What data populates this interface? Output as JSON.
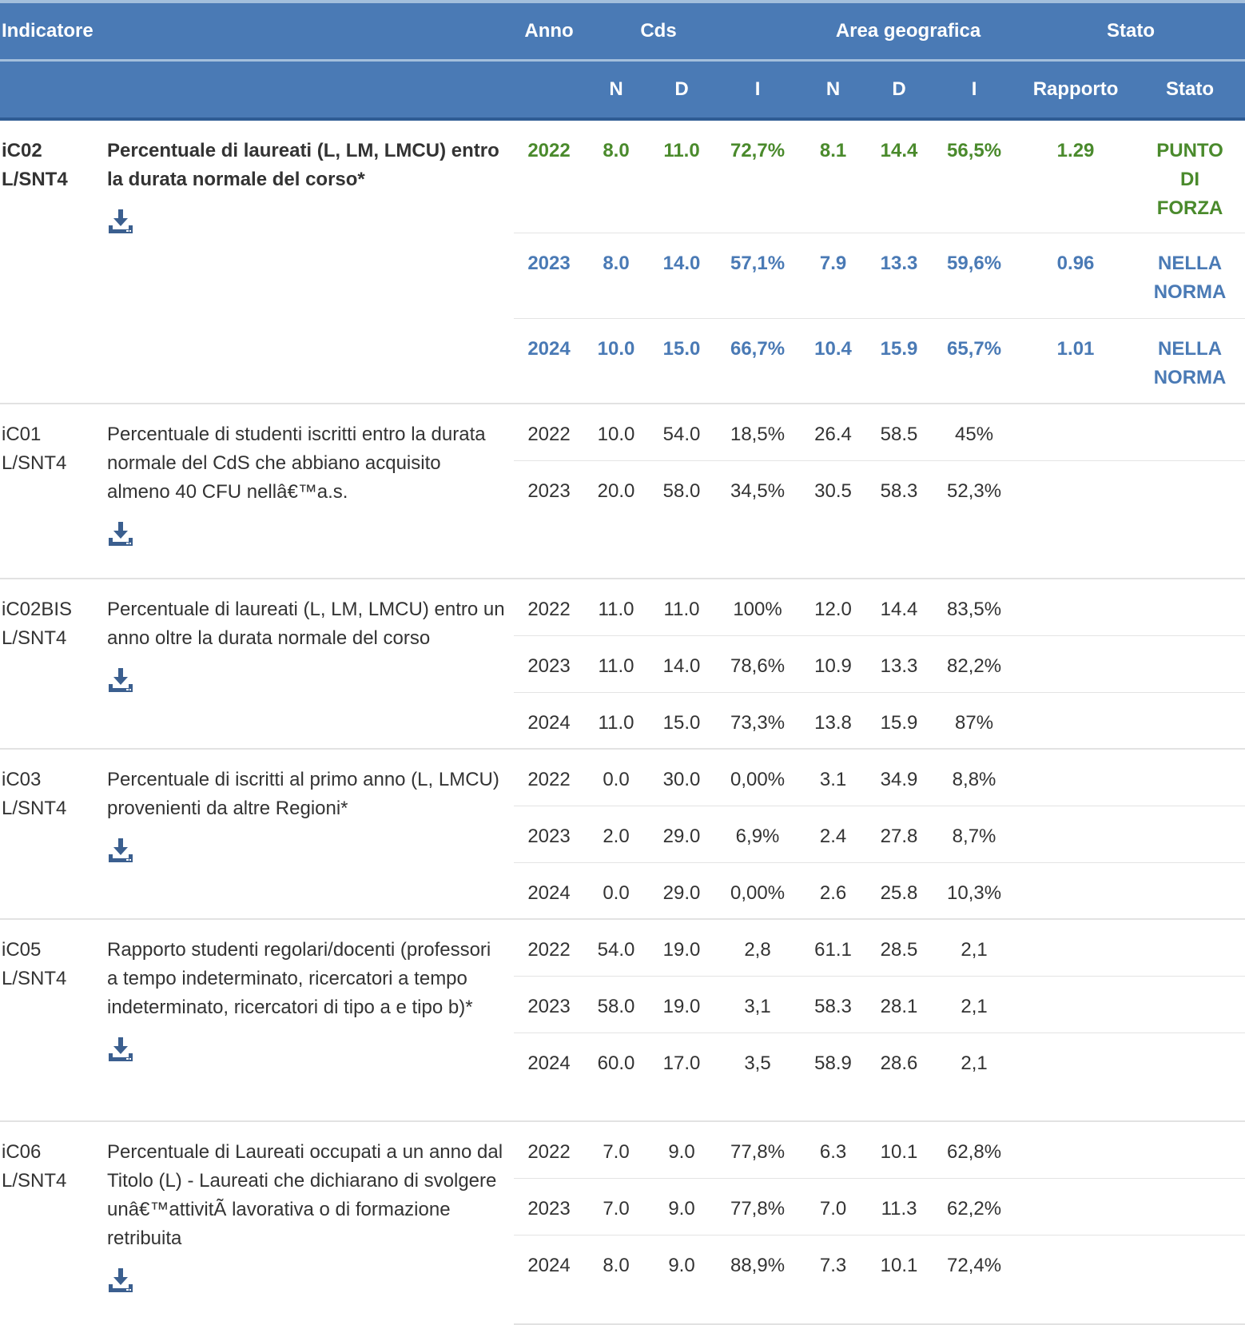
{
  "header": {
    "indicatore": "Indicatore",
    "anno": "Anno",
    "cds": "Cds",
    "area": "Area geografica",
    "stato": "Stato",
    "sub_n": "N",
    "sub_d": "D",
    "sub_i": "I",
    "sub_rapporto": "Rapporto",
    "sub_stato": "Stato"
  },
  "colors": {
    "header_bg": "#4a7ab5",
    "positive": "#4a8a2c",
    "normal": "#4a7ab5"
  },
  "icon": "download-icon",
  "indicators": [
    {
      "code": "iC02 L/SNT4",
      "desc": "Percentuale di laureati (L, LM, LMCU) entro la durata normale del corso*",
      "rows": [
        {
          "anno": "2022",
          "n": "8.0",
          "d": "11.0",
          "i": "72,7%",
          "an": "8.1",
          "ad": "14.4",
          "ai": "56,5%",
          "rapporto": "1.29",
          "stato": "PUNTO DI FORZA",
          "color": "green"
        },
        {
          "anno": "2023",
          "n": "8.0",
          "d": "14.0",
          "i": "57,1%",
          "an": "7.9",
          "ad": "13.3",
          "ai": "59,6%",
          "rapporto": "0.96",
          "stato": "NELLA NORMA",
          "color": "blue"
        },
        {
          "anno": "2024",
          "n": "10.0",
          "d": "15.0",
          "i": "66,7%",
          "an": "10.4",
          "ad": "15.9",
          "ai": "65,7%",
          "rapporto": "1.01",
          "stato": "NELLA NORMA",
          "color": "blue"
        }
      ]
    },
    {
      "code": "iC01 L/SNT4",
      "desc": "Percentuale di studenti iscritti entro la durata normale del CdS che abbiano acquisito almeno 40 CFU nellâ€™a.s.",
      "rows": [
        {
          "anno": "2022",
          "n": "10.0",
          "d": "54.0",
          "i": "18,5%",
          "an": "26.4",
          "ad": "58.5",
          "ai": "45%"
        },
        {
          "anno": "2023",
          "n": "20.0",
          "d": "58.0",
          "i": "34,5%",
          "an": "30.5",
          "ad": "58.3",
          "ai": "52,3%"
        }
      ]
    },
    {
      "code": "iC02BIS L/SNT4",
      "desc": "Percentuale di laureati (L, LM, LMCU) entro un anno oltre la durata normale del corso",
      "rows": [
        {
          "anno": "2022",
          "n": "11.0",
          "d": "11.0",
          "i": "100%",
          "an": "12.0",
          "ad": "14.4",
          "ai": "83,5%"
        },
        {
          "anno": "2023",
          "n": "11.0",
          "d": "14.0",
          "i": "78,6%",
          "an": "10.9",
          "ad": "13.3",
          "ai": "82,2%"
        },
        {
          "anno": "2024",
          "n": "11.0",
          "d": "15.0",
          "i": "73,3%",
          "an": "13.8",
          "ad": "15.9",
          "ai": "87%"
        }
      ]
    },
    {
      "code": "iC03 L/SNT4",
      "desc": "Percentuale di iscritti al primo anno (L, LMCU) provenienti da altre Regioni*",
      "rows": [
        {
          "anno": "2022",
          "n": "0.0",
          "d": "30.0",
          "i": "0,00%",
          "an": "3.1",
          "ad": "34.9",
          "ai": "8,8%"
        },
        {
          "anno": "2023",
          "n": "2.0",
          "d": "29.0",
          "i": "6,9%",
          "an": "2.4",
          "ad": "27.8",
          "ai": "8,7%"
        },
        {
          "anno": "2024",
          "n": "0.0",
          "d": "29.0",
          "i": "0,00%",
          "an": "2.6",
          "ad": "25.8",
          "ai": "10,3%"
        }
      ]
    },
    {
      "code": "iC05 L/SNT4",
      "desc": "Rapporto studenti regolari/docenti (professori a tempo indeterminato, ricercatori a tempo indeterminato, ricercatori di tipo a e tipo b)*",
      "rows": [
        {
          "anno": "2022",
          "n": "54.0",
          "d": "19.0",
          "i": "2,8",
          "an": "61.1",
          "ad": "28.5",
          "ai": "2,1"
        },
        {
          "anno": "2023",
          "n": "58.0",
          "d": "19.0",
          "i": "3,1",
          "an": "58.3",
          "ad": "28.1",
          "ai": "2,1"
        },
        {
          "anno": "2024",
          "n": "60.0",
          "d": "17.0",
          "i": "3,5",
          "an": "58.9",
          "ad": "28.6",
          "ai": "2,1"
        }
      ]
    },
    {
      "code": "iC06 L/SNT4",
      "desc": "Percentuale di Laureati occupati a un anno dal Titolo (L) - Laureati che dichiarano di svolgere unâ€™attivitÃ  lavorativa o di formazione retribuita",
      "rows": [
        {
          "anno": "2022",
          "n": "7.0",
          "d": "9.0",
          "i": "77,8%",
          "an": "6.3",
          "ad": "10.1",
          "ai": "62,8%"
        },
        {
          "anno": "2023",
          "n": "7.0",
          "d": "9.0",
          "i": "77,8%",
          "an": "7.0",
          "ad": "11.3",
          "ai": "62,2%"
        },
        {
          "anno": "2024",
          "n": "8.0",
          "d": "9.0",
          "i": "88,9%",
          "an": "7.3",
          "ad": "10.1",
          "ai": "72,4%"
        }
      ]
    }
  ]
}
